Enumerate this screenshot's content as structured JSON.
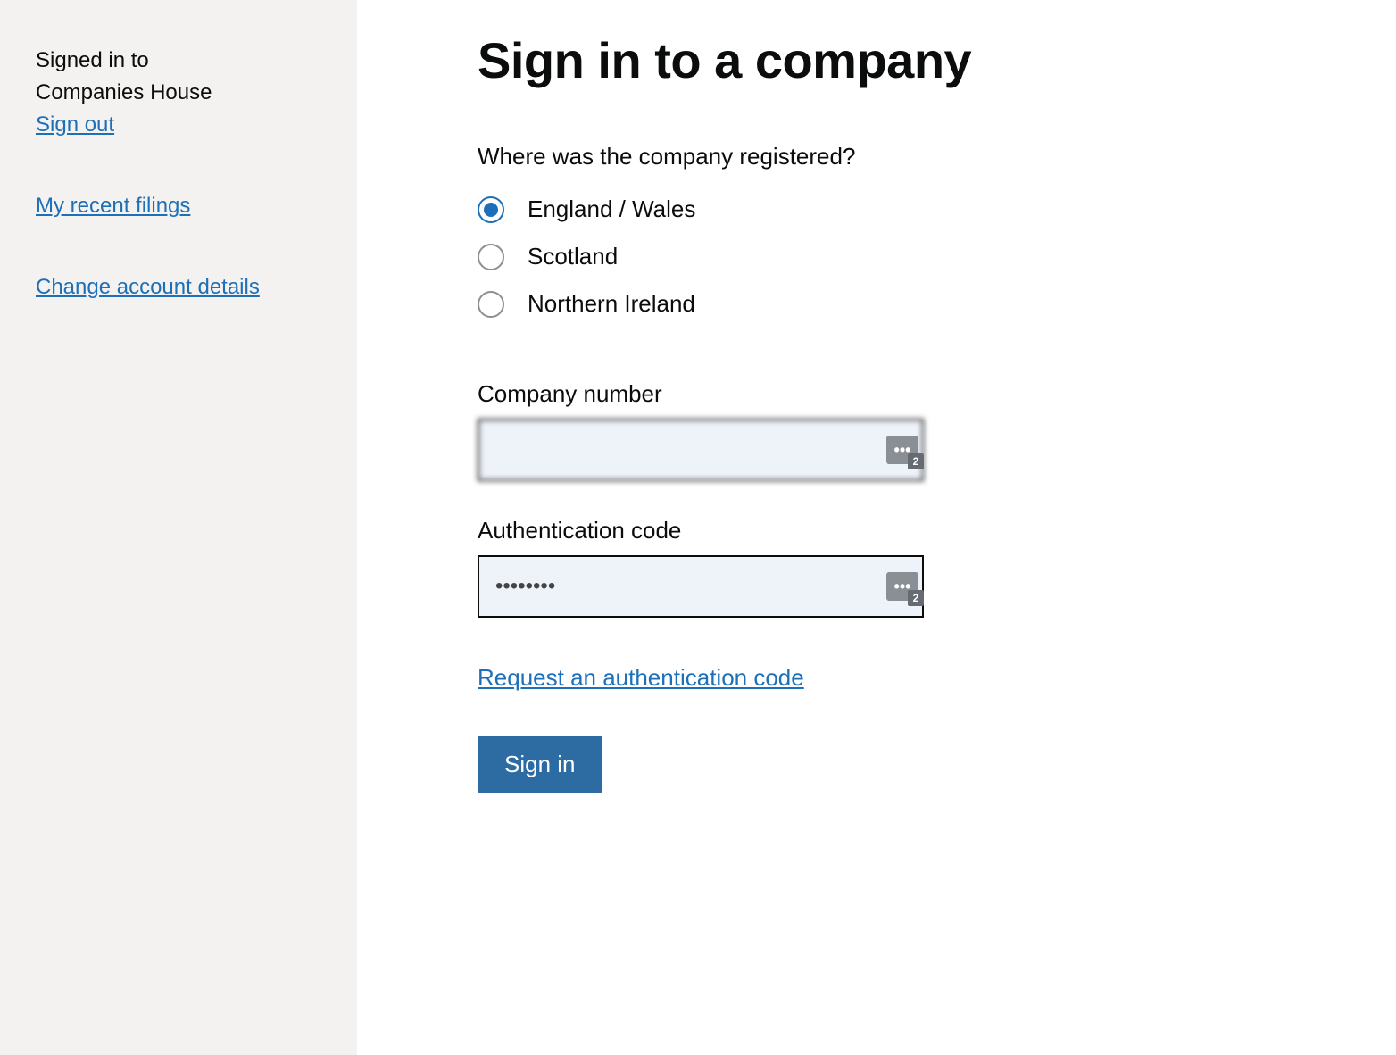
{
  "sidebar": {
    "signed_in_line1": "Signed in to",
    "signed_in_line2": "Companies House",
    "sign_out_label": "Sign out",
    "recent_filings_label": "My recent filings",
    "change_account_label": "Change account details"
  },
  "main": {
    "heading": "Sign in to a company",
    "question": "Where was the company registered?",
    "radios": [
      {
        "label": "England / Wales",
        "selected": true
      },
      {
        "label": "Scotland",
        "selected": false
      },
      {
        "label": "Northern Ireland",
        "selected": false
      }
    ],
    "company_number": {
      "label": "Company number",
      "value": ""
    },
    "auth_code": {
      "label": "Authentication code",
      "value": "••••••••"
    },
    "request_code_label": "Request an authentication code",
    "signin_button": "Sign in",
    "pw_badge_count": "2"
  }
}
